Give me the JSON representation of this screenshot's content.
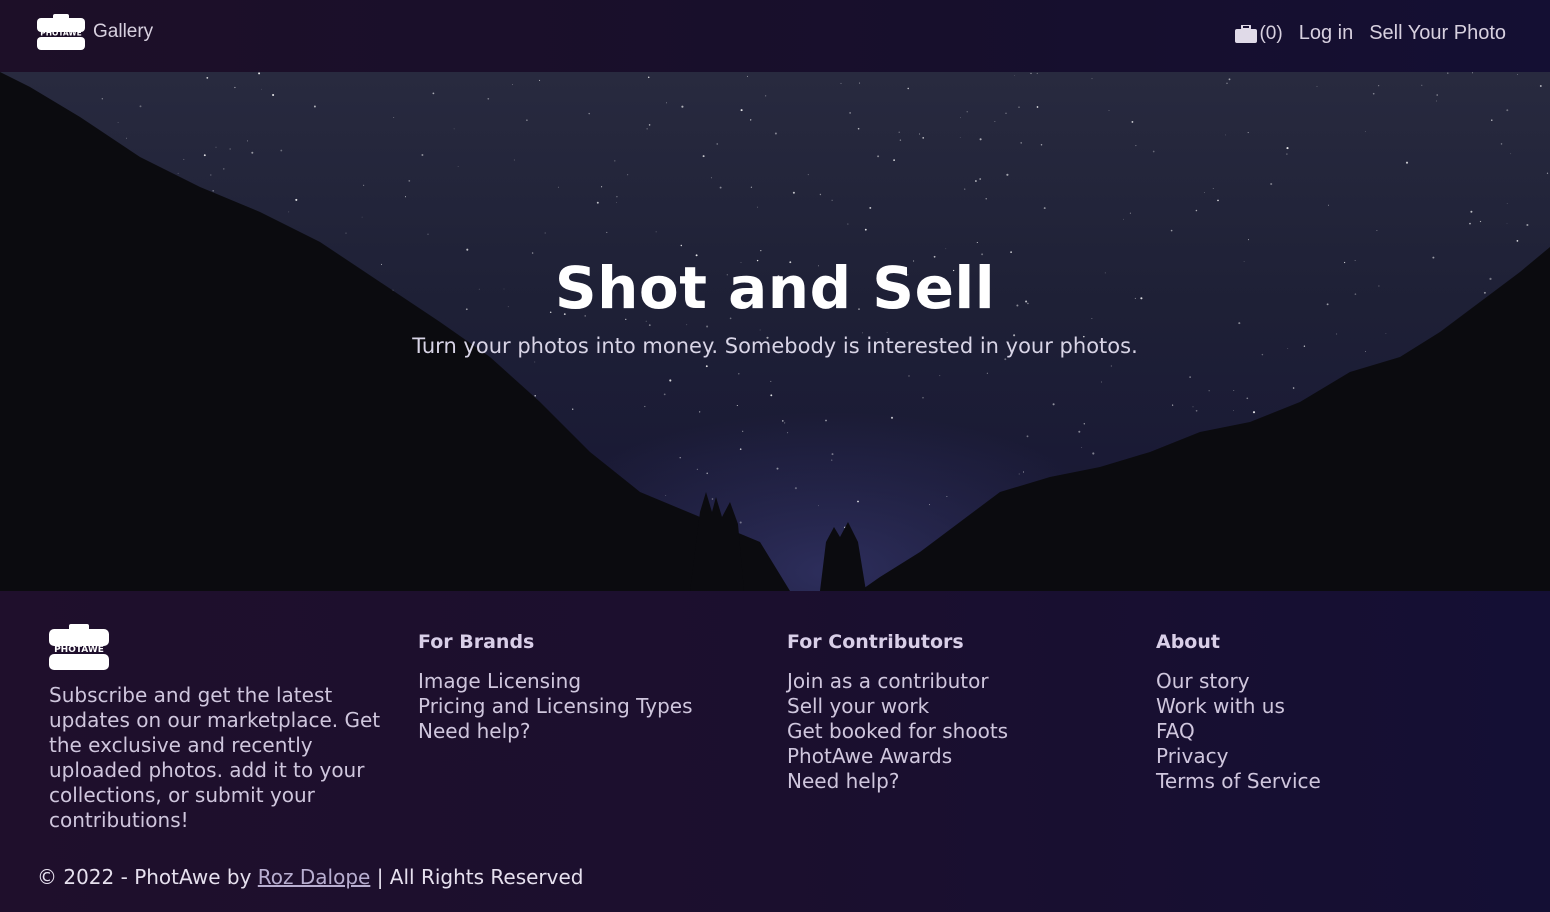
{
  "navbar": {
    "logo_text": "PHOTAWE",
    "gallery_label": "Gallery",
    "cart_count": "(0)",
    "login_label": "Log in",
    "sell_label": "Sell Your Photo"
  },
  "hero": {
    "title": "Shot and Sell",
    "subtitle": "Turn your photos into money. Somebody is interested in your photos."
  },
  "footer": {
    "logo_text": "PHOTAWE",
    "subscribe_text": "Subscribe and get the latest updates on our marketplace. Get the exclusive and recently uploaded photos. add it to your collections, or submit your contributions!",
    "columns": [
      {
        "title": "For Brands",
        "items": [
          "Image Licensing",
          "Pricing and Licensing Types",
          "Need help?"
        ]
      },
      {
        "title": "For Contributors",
        "items": [
          "Join as a contributor",
          "Sell your work",
          "Get booked for shoots",
          "PhotAwe Awards",
          "Need help?"
        ]
      },
      {
        "title": "About",
        "items": [
          "Our story",
          "Work with us",
          "FAQ",
          "Privacy",
          "Terms of Service"
        ]
      }
    ],
    "copyright_prefix": "© 2022 - PhotAwe by",
    "author": "Roz Dalope",
    "copyright_suffix": "| All Rights Reserved"
  },
  "colors": {
    "nav_bg": "#1b0f2c",
    "footer_bg": "#1b0f2e",
    "text_light": "#d7d0df"
  }
}
